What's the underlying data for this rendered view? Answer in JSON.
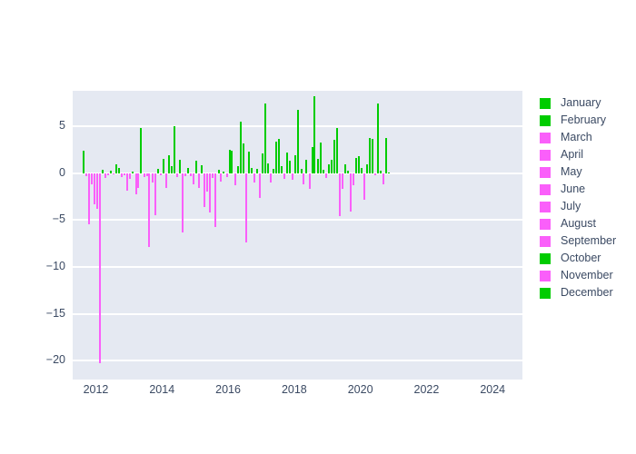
{
  "chart_data": {
    "type": "bar",
    "title": "",
    "subtitle": "",
    "xlabel": "",
    "ylabel": "",
    "xlim": [
      2011.3,
      2024.9
    ],
    "ylim": [
      -22.0,
      8.8
    ],
    "xticks": [
      "2012",
      "2014",
      "2016",
      "2018",
      "2020",
      "2022",
      "2024"
    ],
    "xtick_values": [
      2012,
      2014,
      2016,
      2018,
      2020,
      2022,
      2024
    ],
    "yticks": [
      "5",
      "0",
      "−5",
      "−10",
      "−15",
      "−20"
    ],
    "ytick_values": [
      5,
      0,
      -5,
      -10,
      -15,
      -20
    ],
    "grid": true,
    "grid_color": "#ffffff",
    "plot_background": "#e5e9f2",
    "page_background": "#ffffff",
    "positive_color": "#00cc00",
    "negative_color": "#fa5ffa",
    "legend_position": "right",
    "legend": [
      {
        "label": "January",
        "color": "#00cc00"
      },
      {
        "label": "February",
        "color": "#00cc00"
      },
      {
        "label": "March",
        "color": "#fa5ffa"
      },
      {
        "label": "April",
        "color": "#fa5ffa"
      },
      {
        "label": "May",
        "color": "#fa5ffa"
      },
      {
        "label": "June",
        "color": "#fa5ffa"
      },
      {
        "label": "July",
        "color": "#fa5ffa"
      },
      {
        "label": "August",
        "color": "#fa5ffa"
      },
      {
        "label": "September",
        "color": "#fa5ffa"
      },
      {
        "label": "October",
        "color": "#00cc00"
      },
      {
        "label": "November",
        "color": "#fa5ffa"
      },
      {
        "label": "December",
        "color": "#00cc00"
      }
    ],
    "x": [
      2011.62,
      2011.71,
      2011.79,
      2011.87,
      2011.96,
      2012.04,
      2012.12,
      2012.21,
      2012.29,
      2012.37,
      2012.46,
      2012.54,
      2012.62,
      2012.71,
      2012.79,
      2012.87,
      2012.96,
      2013.04,
      2013.12,
      2013.21,
      2013.29,
      2013.37,
      2013.46,
      2013.54,
      2013.62,
      2013.71,
      2013.79,
      2013.87,
      2013.96,
      2014.04,
      2014.12,
      2014.21,
      2014.29,
      2014.37,
      2014.46,
      2014.54,
      2014.62,
      2014.71,
      2014.79,
      2014.87,
      2014.96,
      2015.04,
      2015.12,
      2015.21,
      2015.29,
      2015.37,
      2015.46,
      2015.54,
      2015.62,
      2015.71,
      2015.79,
      2015.87,
      2015.96,
      2016.04,
      2016.12,
      2016.21,
      2016.29,
      2016.37,
      2016.46,
      2016.54,
      2016.62,
      2016.71,
      2016.79,
      2016.87,
      2016.96,
      2017.04,
      2017.12,
      2017.21,
      2017.29,
      2017.37,
      2017.46,
      2017.54,
      2017.62,
      2017.71,
      2017.79,
      2017.87,
      2017.96,
      2018.04,
      2018.12,
      2018.21,
      2018.29,
      2018.37,
      2018.46,
      2018.54,
      2018.62,
      2018.71,
      2018.79,
      2018.87,
      2018.96,
      2019.04,
      2019.12,
      2019.21,
      2019.29,
      2019.37,
      2019.46,
      2019.54,
      2019.62,
      2019.71,
      2019.79,
      2019.87,
      2019.96,
      2020.04,
      2020.12,
      2020.21,
      2020.29,
      2020.37,
      2020.46,
      2020.54,
      2020.62,
      2020.71,
      2020.79,
      2020.87
    ],
    "values": [
      2.4,
      -0.3,
      -5.4,
      -1.2,
      -3.3,
      -3.8,
      -20.3,
      0.4,
      -0.5,
      -0.2,
      0.3,
      -0.1,
      1.0,
      0.6,
      -0.4,
      -0.2,
      -1.9,
      -0.6,
      0.2,
      -2.2,
      -1.6,
      4.8,
      -0.4,
      -0.3,
      -7.9,
      -1.0,
      -4.5,
      0.5,
      -0.2,
      1.5,
      -1.6,
      1.9,
      0.8,
      5.0,
      -0.4,
      1.4,
      -6.3,
      -0.3,
      0.6,
      -0.3,
      -1.2,
      1.3,
      -1.6,
      0.9,
      -3.6,
      -2.0,
      -4.2,
      -0.5,
      -5.7,
      0.4,
      -0.9,
      0.2,
      -0.4,
      2.5,
      2.4,
      -1.3,
      0.8,
      5.5,
      3.2,
      -7.4,
      2.3,
      0.6,
      -1.0,
      0.5,
      -2.6,
      2.1,
      7.4,
      1.1,
      -1.0,
      0.5,
      3.4,
      3.7,
      0.8,
      -0.6,
      2.2,
      1.3,
      -0.7,
      1.9,
      6.8,
      0.5,
      -1.2,
      1.4,
      -1.7,
      2.8,
      8.2,
      1.5,
      3.3,
      0.4,
      -0.5,
      1.0,
      1.4,
      3.6,
      4.8,
      -4.6,
      -1.7,
      1.0,
      0.3,
      -4.1,
      -1.3,
      1.6,
      1.8,
      0.6,
      -2.8,
      1.0,
      3.8,
      3.7,
      -0.2,
      7.4,
      0.3,
      -1.2,
      3.8,
      0.1
    ]
  }
}
